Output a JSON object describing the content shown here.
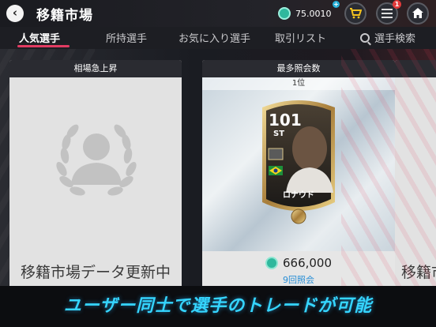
{
  "header": {
    "title": "移籍市場",
    "coins": "75.0010",
    "plus": "+",
    "notification_count": "1",
    "icons": {
      "back": "back-arrow-icon",
      "coin": "coin-icon",
      "cart": "shopping-cart-icon",
      "list": "list-icon",
      "home": "home-icon"
    }
  },
  "tabs": [
    {
      "label": "人気選手",
      "active": true
    },
    {
      "label": "所持選手"
    },
    {
      "label": "お気に入り選手"
    },
    {
      "label": "取引リスト"
    },
    {
      "label": "選手検索"
    }
  ],
  "panels": {
    "left": {
      "header": "相場急上昇",
      "status": "移籍市場データ更新中"
    },
    "center": {
      "header": "最多照会数",
      "rank": "1位",
      "card": {
        "rating": "101",
        "position": "ST",
        "name": "ロナウド"
      },
      "price": "666,000",
      "views": "9回照会"
    },
    "right": {
      "status": "移籍市"
    }
  },
  "banner": {
    "text": "ユーザー同士で選手のトレードが可能"
  },
  "colors": {
    "accent": "#e23b62",
    "coin": "#2fb89d",
    "banner_text": "#35d5ff",
    "views": "#2a8fd6"
  }
}
